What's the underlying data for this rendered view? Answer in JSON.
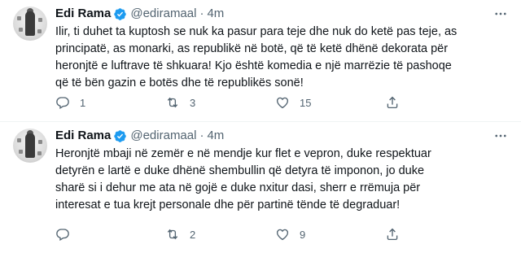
{
  "tweets": [
    {
      "name": "Edi Rama",
      "handle": "@ediramaal",
      "separator": "·",
      "time": "4m",
      "lines": [
        "Ilir, ti duhet ta kuptosh se nuk ka pasur para teje dhe nuk do ketë pas teje, as",
        "principatë, as monarki, as republikë në botë, që të ketë dhënë dekorata për",
        "heronjtë e luftrave të shkuara! Kjo është komedia e një marrëzie të pashoqe",
        "që të bën gazin e botës dhe të republikës sonë!"
      ],
      "replies": "1",
      "retweets": "3",
      "likes": "15"
    },
    {
      "name": "Edi Rama",
      "handle": "@ediramaal",
      "separator": "·",
      "time": "4m",
      "lines": [
        "Heronjtë mbaji në zemër e në mendje kur flet e vepron, duke respektuar",
        "detyrën e lartë e duke dhënë shembullin që detyra të imponon, jo duke",
        "sharë si i dehur me ata në gojë e duke nxitur dasi, sherr e rrëmuja për",
        "interesat e tua krejt personale dhe për partinë tënde të degraduar!"
      ],
      "replies": "",
      "retweets": "2",
      "likes": "9"
    }
  ],
  "colors": {
    "verified": "#1d9bf0",
    "muted": "#536471",
    "text": "#0f1419"
  },
  "icons": [
    "verified-badge-icon",
    "more-icon",
    "reply-icon",
    "retweet-icon",
    "like-icon",
    "share-icon"
  ]
}
